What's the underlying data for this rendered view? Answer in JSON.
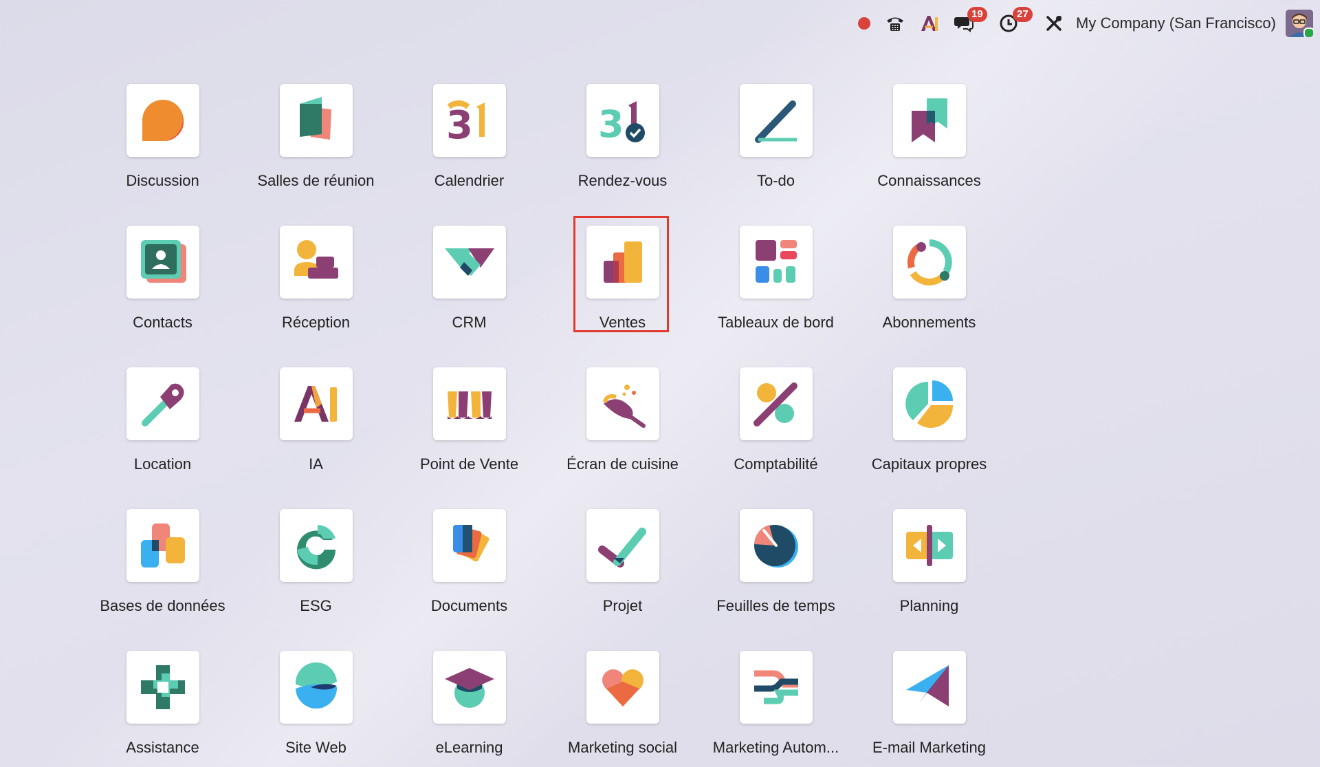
{
  "topbar": {
    "record_icon": "record-dot-icon",
    "phone_icon": "phone-icon",
    "ai_icon": "ai-icon",
    "messages_icon": "chat-icon",
    "messages_count": "19",
    "activities_icon": "clock-icon",
    "activities_count": "27",
    "debug_icon": "tools-icon",
    "company": "My Company (San Francisco)",
    "avatar_icon": "user-avatar"
  },
  "apps": [
    {
      "label": "Discussion",
      "icon": "discussion-icon"
    },
    {
      "label": "Salles de réunion",
      "icon": "meeting-rooms-icon"
    },
    {
      "label": "Calendrier",
      "icon": "calendar-icon"
    },
    {
      "label": "Rendez-vous",
      "icon": "appointments-icon"
    },
    {
      "label": "To-do",
      "icon": "todo-icon"
    },
    {
      "label": "Connaissances",
      "icon": "knowledge-icon"
    },
    {
      "label": "Contacts",
      "icon": "contacts-icon"
    },
    {
      "label": "Réception",
      "icon": "reception-icon"
    },
    {
      "label": "CRM",
      "icon": "crm-icon"
    },
    {
      "label": "Ventes",
      "icon": "sales-icon",
      "selected": true
    },
    {
      "label": "Tableaux de bord",
      "icon": "dashboards-icon"
    },
    {
      "label": "Abonnements",
      "icon": "subscriptions-icon"
    },
    {
      "label": "Location",
      "icon": "rental-icon"
    },
    {
      "label": "IA",
      "icon": "ai-app-icon"
    },
    {
      "label": "Point de Vente",
      "icon": "point-of-sale-icon"
    },
    {
      "label": "Écran de cuisine",
      "icon": "kitchen-display-icon"
    },
    {
      "label": "Comptabilité",
      "icon": "accounting-icon"
    },
    {
      "label": "Capitaux propres",
      "icon": "equity-icon"
    },
    {
      "label": "Bases de données",
      "icon": "databases-icon"
    },
    {
      "label": "ESG",
      "icon": "esg-icon"
    },
    {
      "label": "Documents",
      "icon": "documents-icon"
    },
    {
      "label": "Projet",
      "icon": "project-icon"
    },
    {
      "label": "Feuilles de temps",
      "icon": "timesheets-icon"
    },
    {
      "label": "Planning",
      "icon": "planning-icon"
    },
    {
      "label": "Assistance",
      "icon": "helpdesk-icon"
    },
    {
      "label": "Site Web",
      "icon": "website-icon"
    },
    {
      "label": "eLearning",
      "icon": "elearning-icon"
    },
    {
      "label": "Marketing social",
      "icon": "social-marketing-icon"
    },
    {
      "label": "Marketing Autom...",
      "icon": "marketing-automation-icon"
    },
    {
      "label": "E-mail Marketing",
      "icon": "email-marketing-icon"
    }
  ]
}
